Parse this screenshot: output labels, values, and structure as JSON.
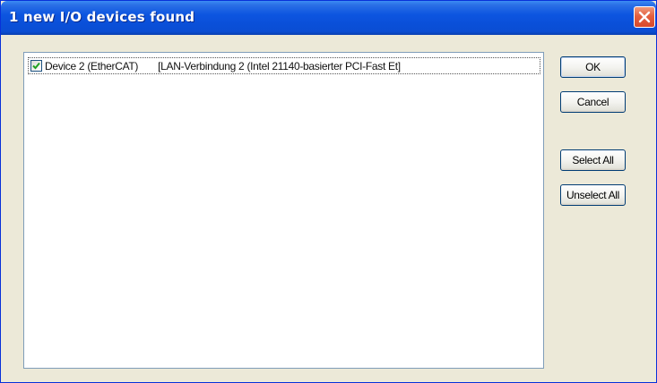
{
  "window": {
    "title": "1 new I/O devices found"
  },
  "titlebar": {
    "close_icon": "close-icon"
  },
  "device_list": {
    "items": [
      {
        "checked": true,
        "name": "Device 2 (EtherCAT)",
        "adapter": "[LAN-Verbindung 2 (Intel 21140-basierter PCI-Fast Et]"
      }
    ]
  },
  "buttons": {
    "ok_label": "OK",
    "cancel_label": "Cancel",
    "select_all_label": "Select All",
    "unselect_all_label": "Unselect All"
  },
  "colors": {
    "titlebar": "#0a4fd8",
    "dialog_face": "#ece9d8",
    "close_button": "#d8492b",
    "button_border": "#003c74"
  }
}
